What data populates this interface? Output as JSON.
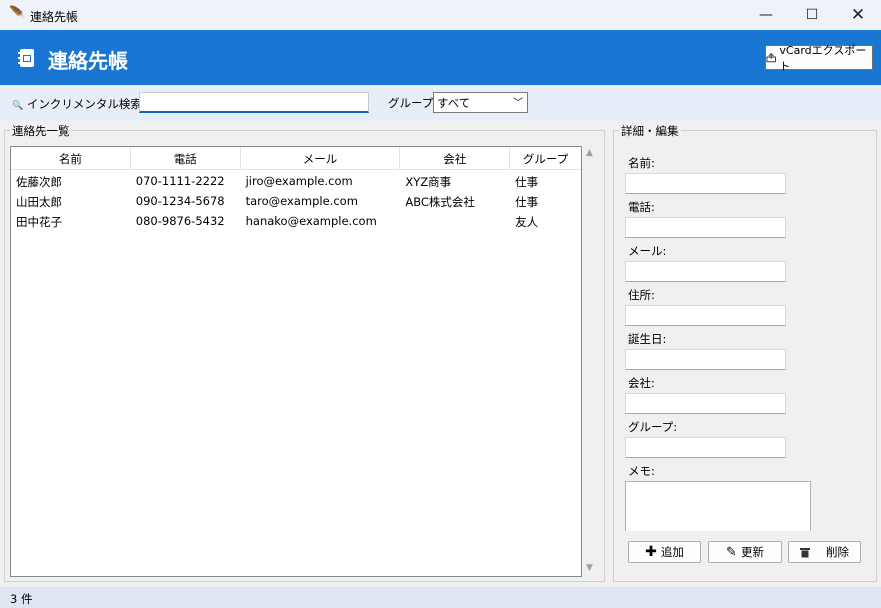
{
  "window": {
    "title": "連絡先帳",
    "minimize": "—",
    "maximize": "☐",
    "close": "✕"
  },
  "header": {
    "title": "連絡先帳",
    "export_label": "vCardエクスポート"
  },
  "search": {
    "label": "インクリメンタル検索:",
    "value": "",
    "group_label": "グループ:",
    "group_value": "すべて"
  },
  "list": {
    "legend": "連絡先一覧",
    "columns": [
      "名前",
      "電話",
      "メール",
      "会社",
      "グループ"
    ],
    "rows": [
      [
        "佐藤次郎",
        "070-1111-2222",
        "jiro@example.com",
        "XYZ商事",
        "仕事"
      ],
      [
        "山田太郎",
        "090-1234-5678",
        "taro@example.com",
        "ABC株式会社",
        "仕事"
      ],
      [
        "田中花子",
        "080-9876-5432",
        "hanako@example.com",
        "",
        "友人"
      ]
    ]
  },
  "detail": {
    "legend": "詳細・編集",
    "fields": [
      {
        "label": "名前:",
        "value": ""
      },
      {
        "label": "電話:",
        "value": ""
      },
      {
        "label": "メール:",
        "value": ""
      },
      {
        "label": "住所:",
        "value": ""
      },
      {
        "label": "誕生日:",
        "value": ""
      },
      {
        "label": "会社:",
        "value": ""
      },
      {
        "label": "グループ:",
        "value": ""
      }
    ],
    "memo_label": "メモ:",
    "memo_value": "",
    "add_label": "追加",
    "update_label": "更新",
    "delete_label": "削除"
  },
  "status": {
    "text": "3 件"
  },
  "colors": {
    "header": "#1976d2",
    "search_row": "#e8eef7",
    "status": "#dfe6f2"
  }
}
